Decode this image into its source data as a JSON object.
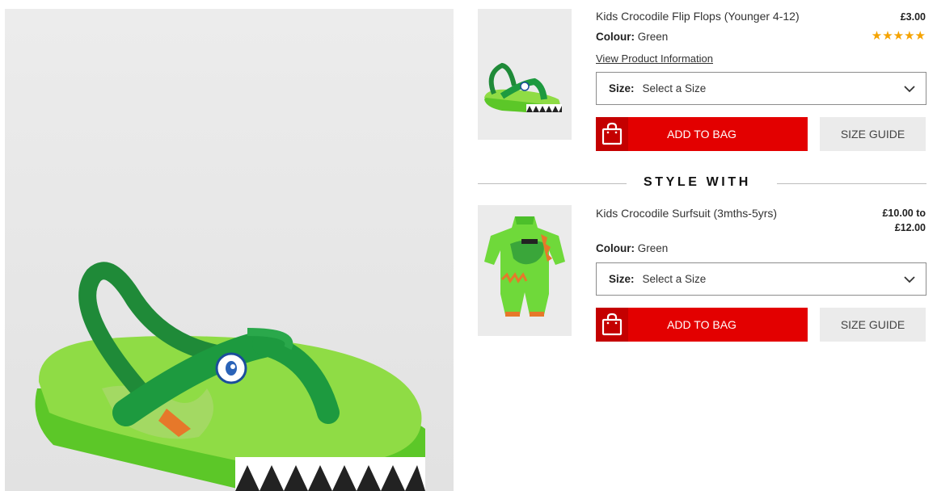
{
  "main_product": {
    "title": "Kids Crocodile Flip Flops (Younger 4-12)",
    "price": "£3.00",
    "rating_stars": "★★★★★",
    "colour_label": "Colour:",
    "colour_value": "Green",
    "info_link": "View Product Information",
    "size_label": "Size:",
    "size_placeholder": "Select a Size",
    "add_to_bag": "ADD TO BAG",
    "size_guide": "SIZE GUIDE"
  },
  "style_with": {
    "heading": "STYLE WITH",
    "item": {
      "title": "Kids Crocodile Surfsuit (3mths-5yrs)",
      "price_line1": "£10.00 to",
      "price_line2": "£12.00",
      "colour_label": "Colour:",
      "colour_value": "Green",
      "size_label": "Size:",
      "size_placeholder": "Select a Size",
      "add_to_bag": "ADD TO BAG",
      "size_guide": "SIZE GUIDE"
    }
  },
  "colors": {
    "accent_red": "#e30000",
    "star_gold": "#f5a300",
    "button_grey": "#ebebeb"
  }
}
